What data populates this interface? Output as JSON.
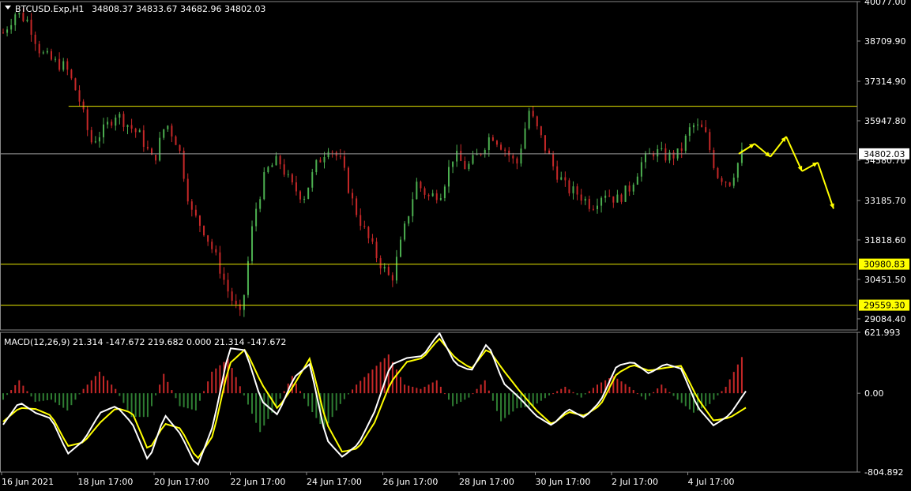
{
  "header": {
    "title": "BTCUSD.Exp,H1",
    "ohlc": "34808.37 34833.67 34682.96 34802.03"
  },
  "colors": {
    "background": "#000000",
    "bull": "#4caf50",
    "bear": "#c62828",
    "level_line": "#e6e600",
    "price_label_bg": "#ffff00",
    "macd_line": "#ffffff",
    "signal_line": "#ffff00",
    "axis_text": "#ffffff"
  },
  "chart_data": [
    {
      "type": "candlestick",
      "name": "price",
      "ylim": [
        28700,
        40077
      ],
      "y_ticks": [
        "40077.00",
        "38709.90",
        "37314.90",
        "35947.80",
        "34580.70",
        "33185.70",
        "31818.60",
        "30451.50",
        "29084.40"
      ],
      "y_tick_values": [
        40077,
        38709.9,
        37314.9,
        35947.8,
        34580.7,
        33185.7,
        31818.6,
        30451.5,
        29084.4
      ],
      "current_price": "34802.03",
      "current_value": 34802.03,
      "levels": [
        {
          "label": "30980.83",
          "value": 30980.83
        },
        {
          "label": "29559.30",
          "value": 29559.3
        }
      ],
      "resistance": [
        {
          "from": 0.08,
          "to": 1.0,
          "value": 36450
        },
        {
          "from": 0.0,
          "to": 1.0,
          "value": 34802
        }
      ],
      "x_ticks": [
        "16 Jun 2021",
        "18 Jun 17:00",
        "20 Jun 17:00",
        "22 Jun 17:00",
        "24 Jun 17:00",
        "26 Jun 17:00",
        "28 Jun 17:00",
        "30 Jun 17:00",
        "2 Jul 17:00",
        "4 Jul 17:00"
      ],
      "close_path": [
        39000,
        39700,
        39400,
        38300,
        38000,
        37800,
        36800,
        35200,
        35600,
        36200,
        35800,
        35400,
        34500,
        35900,
        35100,
        32800,
        32200,
        31200,
        30000,
        29100,
        32600,
        34200,
        34600,
        33700,
        33300,
        34400,
        35100,
        34500,
        33000,
        32000,
        31100,
        30400,
        32100,
        33800,
        33300,
        33500,
        34800,
        34300,
        34800,
        35500,
        35000,
        34400,
        36300,
        35300,
        34300,
        33600,
        33400,
        33000,
        33500,
        33200,
        33600,
        34500,
        34900,
        34700,
        34800,
        35800,
        35600,
        34100,
        33800,
        34802
      ],
      "forecast_path": [
        34802,
        35150,
        34700,
        35400,
        34200,
        34500,
        32900
      ]
    },
    {
      "type": "line",
      "name": "MACD(12,26,9)",
      "label": "MACD(12,26,9) 21.314 -147.672 219.682 0.000 21.314 -147.672",
      "ylim": [
        -804.892,
        621.993
      ],
      "y_ticks": [
        "621.993",
        "0.00",
        "-804.892"
      ],
      "y_tick_values": [
        621.993,
        0,
        -804.892
      ],
      "macd_path": [
        -320,
        -90,
        -200,
        -260,
        -620,
        -480,
        -200,
        -130,
        -310,
        -700,
        -220,
        -420,
        -760,
        -330,
        460,
        440,
        -80,
        -220,
        160,
        300,
        -470,
        -650,
        -520,
        -190,
        290,
        360,
        380,
        620,
        300,
        230,
        520,
        100,
        -50,
        -230,
        -330,
        -160,
        -250,
        -80,
        280,
        320,
        200,
        300,
        250,
        -140,
        -330,
        -220,
        21
      ],
      "signal_path": [
        -290,
        -150,
        -160,
        -230,
        -540,
        -500,
        -300,
        -150,
        -200,
        -590,
        -310,
        -360,
        -680,
        -430,
        300,
        450,
        100,
        -160,
        80,
        360,
        -300,
        -600,
        -560,
        -300,
        110,
        320,
        360,
        560,
        360,
        250,
        460,
        230,
        20,
        -170,
        -320,
        -190,
        -230,
        -120,
        200,
        290,
        230,
        260,
        280,
        -50,
        -280,
        -250,
        -147
      ]
    }
  ]
}
